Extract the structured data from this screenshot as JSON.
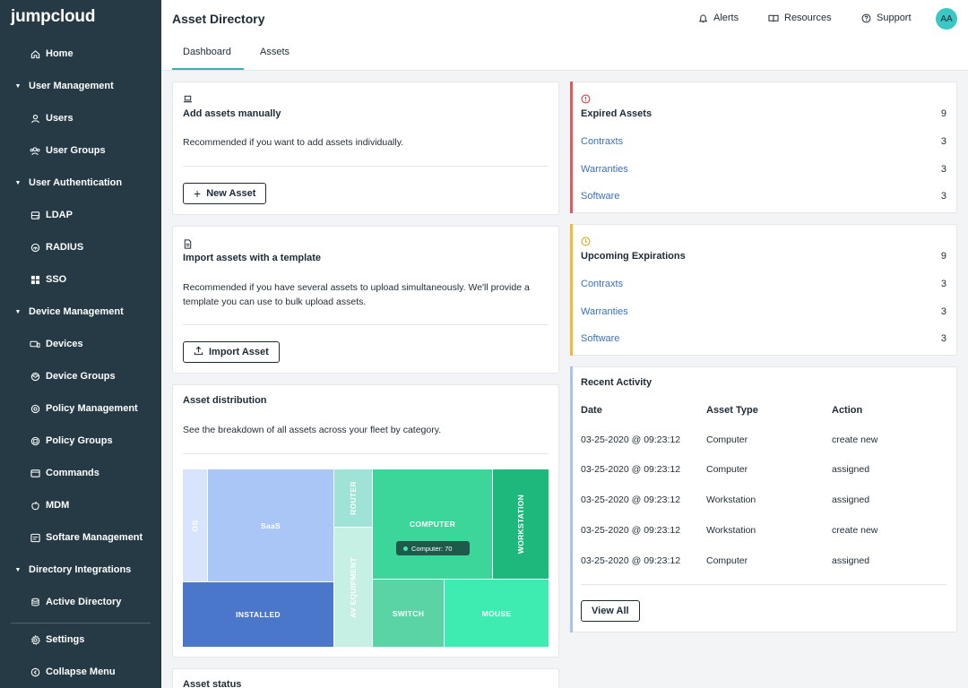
{
  "sidebar": {
    "logo": "jumpcloud",
    "items": [
      {
        "label": "Home",
        "icon": "home-icon",
        "kind": "sub"
      },
      {
        "label": "User Management",
        "icon": "caret-down-icon",
        "kind": "group"
      },
      {
        "label": "Users",
        "icon": "user-icon",
        "kind": "sub"
      },
      {
        "label": "User Groups",
        "icon": "user-group-icon",
        "kind": "sub"
      },
      {
        "label": "User Authentication",
        "icon": "caret-down-icon",
        "kind": "group"
      },
      {
        "label": "LDAP",
        "icon": "ldap-icon",
        "kind": "sub"
      },
      {
        "label": "RADIUS",
        "icon": "radius-icon",
        "kind": "sub"
      },
      {
        "label": "SSO",
        "icon": "sso-icon",
        "kind": "sub"
      },
      {
        "label": "Device Management",
        "icon": "caret-down-icon",
        "kind": "group"
      },
      {
        "label": "Devices",
        "icon": "devices-icon",
        "kind": "sub"
      },
      {
        "label": "Device Groups",
        "icon": "device-groups-icon",
        "kind": "sub"
      },
      {
        "label": "Policy Management",
        "icon": "policy-icon",
        "kind": "sub"
      },
      {
        "label": "Policy Groups",
        "icon": "policy-groups-icon",
        "kind": "sub"
      },
      {
        "label": "Commands",
        "icon": "commands-icon",
        "kind": "sub"
      },
      {
        "label": "MDM",
        "icon": "mdm-icon",
        "kind": "sub"
      },
      {
        "label": "Softare Management",
        "icon": "software-icon",
        "kind": "sub"
      },
      {
        "label": "Directory Integrations",
        "icon": "caret-down-icon",
        "kind": "group"
      },
      {
        "label": "Active Directory",
        "icon": "active-directory-icon",
        "kind": "sub"
      }
    ],
    "settings_label": "Settings",
    "collapse_label": "Collapse Menu"
  },
  "header": {
    "title": "Asset Directory",
    "alerts_label": "Alerts",
    "resources_label": "Resources",
    "support_label": "Support",
    "avatar_initials": "AA",
    "tabs": [
      {
        "label": "Dashboard",
        "active": true
      },
      {
        "label": "Assets",
        "active": false
      }
    ]
  },
  "add_manually": {
    "title": "Add assets manually",
    "description": "Recommended if you want to add assets individually.",
    "button_label": "New Asset"
  },
  "import_template": {
    "title": "Import assets with a template",
    "description": "Recommended if you have several assets to upload simultaneously. We'll provide a template you can use to bulk upload assets.",
    "button_label": "Import Asset"
  },
  "distribution": {
    "title": "Asset distribution",
    "description": "See the breakdown of all assets across your fleet by category.",
    "tooltip": "Computer: 70",
    "tiles": [
      "OS",
      "SaaS",
      "INSTALLED",
      "ROUTER",
      "AV EQUIPMENT",
      "COMPUTER",
      "WORKSTATION",
      "SWITCH",
      "MOUSE"
    ]
  },
  "asset_status": {
    "title": "Asset status"
  },
  "expired": {
    "title": "Expired Assets",
    "total": "9",
    "rows": [
      {
        "label": "Contraxts",
        "value": "3"
      },
      {
        "label": "Warranties",
        "value": "3"
      },
      {
        "label": "Software",
        "value": "3"
      }
    ],
    "accent_color": "#e05a5a"
  },
  "upcoming": {
    "title": "Upcoming Expirations",
    "total": "9",
    "rows": [
      {
        "label": "Contraxts",
        "value": "3"
      },
      {
        "label": "Warranties",
        "value": "3"
      },
      {
        "label": "Software",
        "value": "3"
      }
    ],
    "accent_color": "#f0b93a"
  },
  "recent_activity": {
    "title": "Recent Activity",
    "columns": [
      "Date",
      "Asset Type",
      "Action"
    ],
    "rows": [
      {
        "date": "03-25-2020 @ 09:23:12",
        "type": "Computer",
        "action": "create new"
      },
      {
        "date": "03-25-2020 @ 09:23:12",
        "type": "Computer",
        "action": "assigned"
      },
      {
        "date": "03-25-2020 @ 09:23:12",
        "type": "Workstation",
        "action": "assigned"
      },
      {
        "date": "03-25-2020 @ 09:23:12",
        "type": "Workstation",
        "action": "create new"
      },
      {
        "date": "03-25-2020 @ 09:23:12",
        "type": "Computer",
        "action": "assigned"
      }
    ],
    "view_all_label": "View All",
    "accent_color": "#a9c4e8"
  }
}
